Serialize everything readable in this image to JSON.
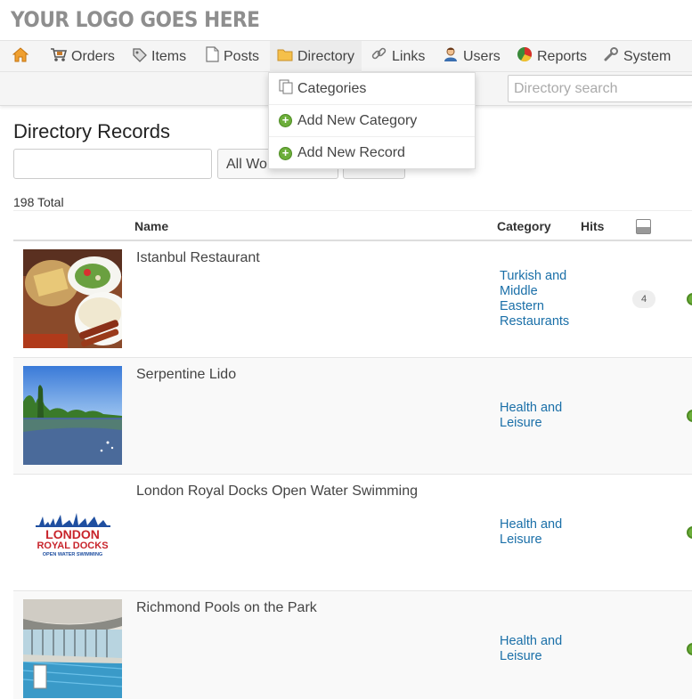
{
  "header": {
    "logo_text": "YOUR LOGO GOES HERE"
  },
  "nav": {
    "items": [
      {
        "label": "",
        "icon": "home-icon"
      },
      {
        "label": "Orders",
        "icon": "cart-icon"
      },
      {
        "label": "Items",
        "icon": "tag-icon"
      },
      {
        "label": "Posts",
        "icon": "document-icon"
      },
      {
        "label": "Directory",
        "icon": "folder-icon"
      },
      {
        "label": "Links",
        "icon": "link-icon"
      },
      {
        "label": "Users",
        "icon": "user-icon"
      },
      {
        "label": "Reports",
        "icon": "pie-chart-icon"
      },
      {
        "label": "System",
        "icon": "wrench-icon"
      }
    ],
    "active": "Directory"
  },
  "search": {
    "placeholder": "Directory search"
  },
  "dropdown": {
    "items": [
      {
        "label": "Categories",
        "icon": "categories-icon"
      },
      {
        "label": "Add New Category",
        "icon": "plus-icon"
      },
      {
        "label": "Add New Record",
        "icon": "plus-icon"
      }
    ]
  },
  "page": {
    "title": "Directory Records",
    "filter_select": "All Words",
    "total": "198 Total"
  },
  "table": {
    "headers": {
      "name": "Name",
      "category": "Category",
      "hits": "Hits"
    },
    "rows": [
      {
        "name": "Istanbul Restaurant",
        "category": "Turkish and Middle Eastern Restaurants",
        "hits": "4",
        "thumb": "food-photo"
      },
      {
        "name": "Serpentine Lido",
        "category": "Health and Leisure",
        "hits": "",
        "thumb": "lake-photo"
      },
      {
        "name": "London Royal Docks Open Water Swimming",
        "category": "Health and Leisure",
        "hits": "",
        "thumb": "logo-image"
      },
      {
        "name": "Richmond Pools on the Park",
        "category": "Health and Leisure",
        "hits": "",
        "thumb": "pool-photo"
      }
    ]
  },
  "thumb_logo": {
    "line1": "LONDON",
    "line2": "ROYAL DOCKS",
    "line3": "OPEN WATER SWIMMING"
  },
  "colors": {
    "link": "#1a6fa8",
    "accent_green": "#6cae3a",
    "logo_red": "#c8242b",
    "logo_blue": "#1f4fa0"
  }
}
